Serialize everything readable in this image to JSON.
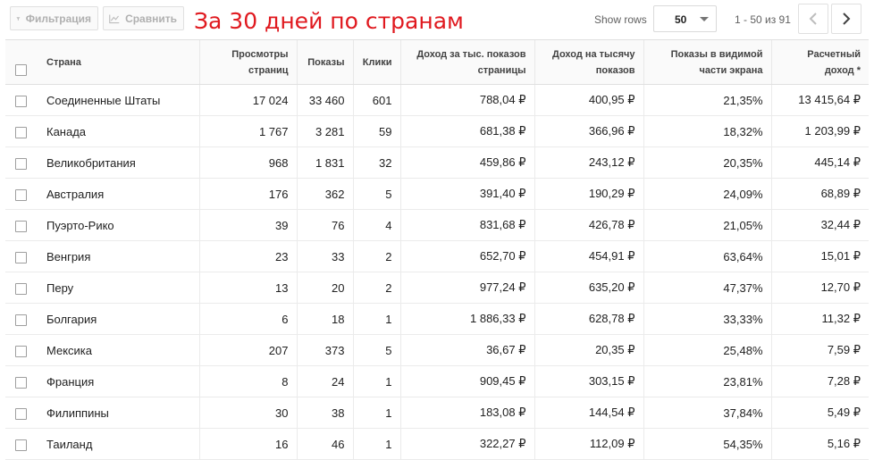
{
  "toolbar": {
    "filter_label": "Фильтрация",
    "compare_label": "Сравнить",
    "annotation": "За 30 дней по странам",
    "show_rows_label": "Show rows",
    "rows_value": "50",
    "range_text": "1 - 50 из 91"
  },
  "icons": {
    "filter": "filter-icon",
    "compare": "compare-chart-icon",
    "prev": "chevron-left-icon",
    "next": "chevron-right-icon",
    "dropdown": "caret-down-icon"
  },
  "colors": {
    "annotation": "#e0191f",
    "header_bg": "#fafafa",
    "border": "#e0e0e0"
  },
  "table": {
    "headers": [
      "Страна",
      "Просмотры\nстраниц",
      "Показы",
      "Клики",
      "Доход за тыс. показов\nстраницы",
      "Доход на тысячу\nпоказов",
      "Показы в видимой\nчасти экрана",
      "Расчетный\nдоход *"
    ],
    "rows": [
      [
        "Соединенные Штаты",
        "17 024",
        "33 460",
        "601",
        "788,04 ₽",
        "400,95 ₽",
        "21,35%",
        "13 415,64 ₽"
      ],
      [
        "Канада",
        "1 767",
        "3 281",
        "59",
        "681,38 ₽",
        "366,96 ₽",
        "18,32%",
        "1 203,99 ₽"
      ],
      [
        "Великобритания",
        "968",
        "1 831",
        "32",
        "459,86 ₽",
        "243,12 ₽",
        "20,35%",
        "445,14 ₽"
      ],
      [
        "Австралия",
        "176",
        "362",
        "5",
        "391,40 ₽",
        "190,29 ₽",
        "24,09%",
        "68,89 ₽"
      ],
      [
        "Пуэрто-Рико",
        "39",
        "76",
        "4",
        "831,68 ₽",
        "426,78 ₽",
        "21,05%",
        "32,44 ₽"
      ],
      [
        "Венгрия",
        "23",
        "33",
        "2",
        "652,70 ₽",
        "454,91 ₽",
        "63,64%",
        "15,01 ₽"
      ],
      [
        "Перу",
        "13",
        "20",
        "2",
        "977,24 ₽",
        "635,20 ₽",
        "47,37%",
        "12,70 ₽"
      ],
      [
        "Болгария",
        "6",
        "18",
        "1",
        "1 886,33 ₽",
        "628,78 ₽",
        "33,33%",
        "11,32 ₽"
      ],
      [
        "Мексика",
        "207",
        "373",
        "5",
        "36,67 ₽",
        "20,35 ₽",
        "25,48%",
        "7,59 ₽"
      ],
      [
        "Франция",
        "8",
        "24",
        "1",
        "909,45 ₽",
        "303,15 ₽",
        "23,81%",
        "7,28 ₽"
      ],
      [
        "Филиппины",
        "30",
        "38",
        "1",
        "183,08 ₽",
        "144,54 ₽",
        "37,84%",
        "5,49 ₽"
      ],
      [
        "Таиланд",
        "16",
        "46",
        "1",
        "322,27 ₽",
        "112,09 ₽",
        "54,35%",
        "5,16 ₽"
      ]
    ]
  }
}
